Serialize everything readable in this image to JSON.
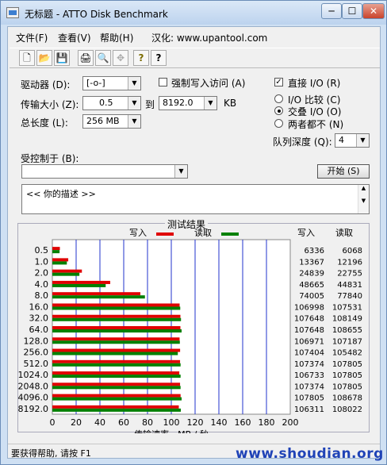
{
  "window": {
    "title": "无标题 - ATTO Disk Benchmark",
    "min": "─",
    "max": "☐",
    "close": "✕"
  },
  "menu": {
    "file": "文件(F)",
    "view": "查看(V)",
    "help": "帮助(H)",
    "localize": "汉化: www.upantool.com"
  },
  "toolbar": {
    "new": "🗋",
    "open": "📂",
    "save": "💾",
    "print": "🖨",
    "preview": "🔍",
    "move": "✥",
    "help": "?",
    "context_help": "?"
  },
  "settings": {
    "drive_label": "驱动器 (D):",
    "drive_value": "[-o-]",
    "transfer_label": "传输大小 (Z):",
    "transfer_from": "0.5",
    "to_label": "到",
    "transfer_to": "8192.0",
    "kb": "KB",
    "length_label": "总长度 (L):",
    "length_value": "256 MB",
    "force_write_label": "强制写入访问 (A)",
    "direct_io_label": "直接 I/O (R)",
    "compare_label": "I/O 比较 (C)",
    "overlapped_label": "交叠 I/O (O)",
    "neither_label": "两者都不 (N)",
    "queue_label": "队列深度 (Q):",
    "queue_value": "4",
    "controlled_label": "受控制于 (B):",
    "controlled_value": "",
    "start_button": "开始 (S)",
    "description": "<<   你的描述    >>"
  },
  "results": {
    "title": "测试结果",
    "write_label": "写入",
    "read_label": "读取",
    "col_write": "写入",
    "col_read": "读取",
    "xlabel": "传输速率 - MB / 秒"
  },
  "chart_data": {
    "type": "bar",
    "orientation": "horizontal",
    "categories": [
      "0.5",
      "1.0",
      "2.0",
      "4.0",
      "8.0",
      "16.0",
      "32.0",
      "64.0",
      "128.0",
      "256.0",
      "512.0",
      "1024.0",
      "2048.0",
      "4096.0",
      "8192.0"
    ],
    "series": [
      {
        "name": "写入",
        "color": "#e00000",
        "values": [
          6336,
          13367,
          24839,
          48665,
          74005,
          106998,
          107648,
          107648,
          106971,
          107404,
          107374,
          106733,
          107374,
          107805,
          106311
        ]
      },
      {
        "name": "读取",
        "color": "#008000",
        "values": [
          6068,
          12196,
          22755,
          44831,
          77840,
          107531,
          108149,
          108655,
          107187,
          105482,
          107805,
          107805,
          107805,
          108678,
          108022
        ]
      }
    ],
    "xlim": [
      0,
      200
    ],
    "xticks": [
      "0",
      "20",
      "40",
      "60",
      "80",
      "100",
      "120",
      "140",
      "160",
      "180",
      "200"
    ],
    "xlabel": "传输速率 - MB / 秒",
    "unit_values": "KB/s",
    "grid": true,
    "legend": "top"
  },
  "status_text": "要获得帮助, 请按 F1",
  "watermark": "www.shoudian.org"
}
